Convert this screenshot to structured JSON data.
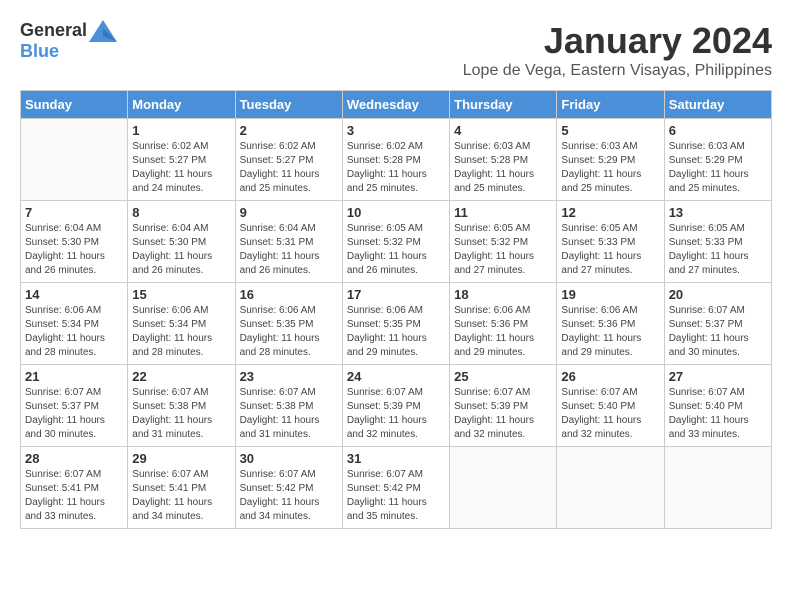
{
  "header": {
    "logo_line1": "General",
    "logo_line2": "Blue",
    "month_title": "January 2024",
    "location": "Lope de Vega, Eastern Visayas, Philippines"
  },
  "days_of_week": [
    "Sunday",
    "Monday",
    "Tuesday",
    "Wednesday",
    "Thursday",
    "Friday",
    "Saturday"
  ],
  "weeks": [
    [
      {
        "num": "",
        "sunrise": "",
        "sunset": "",
        "daylight": ""
      },
      {
        "num": "1",
        "sunrise": "Sunrise: 6:02 AM",
        "sunset": "Sunset: 5:27 PM",
        "daylight": "Daylight: 11 hours and 24 minutes."
      },
      {
        "num": "2",
        "sunrise": "Sunrise: 6:02 AM",
        "sunset": "Sunset: 5:27 PM",
        "daylight": "Daylight: 11 hours and 25 minutes."
      },
      {
        "num": "3",
        "sunrise": "Sunrise: 6:02 AM",
        "sunset": "Sunset: 5:28 PM",
        "daylight": "Daylight: 11 hours and 25 minutes."
      },
      {
        "num": "4",
        "sunrise": "Sunrise: 6:03 AM",
        "sunset": "Sunset: 5:28 PM",
        "daylight": "Daylight: 11 hours and 25 minutes."
      },
      {
        "num": "5",
        "sunrise": "Sunrise: 6:03 AM",
        "sunset": "Sunset: 5:29 PM",
        "daylight": "Daylight: 11 hours and 25 minutes."
      },
      {
        "num": "6",
        "sunrise": "Sunrise: 6:03 AM",
        "sunset": "Sunset: 5:29 PM",
        "daylight": "Daylight: 11 hours and 25 minutes."
      }
    ],
    [
      {
        "num": "7",
        "sunrise": "Sunrise: 6:04 AM",
        "sunset": "Sunset: 5:30 PM",
        "daylight": "Daylight: 11 hours and 26 minutes."
      },
      {
        "num": "8",
        "sunrise": "Sunrise: 6:04 AM",
        "sunset": "Sunset: 5:30 PM",
        "daylight": "Daylight: 11 hours and 26 minutes."
      },
      {
        "num": "9",
        "sunrise": "Sunrise: 6:04 AM",
        "sunset": "Sunset: 5:31 PM",
        "daylight": "Daylight: 11 hours and 26 minutes."
      },
      {
        "num": "10",
        "sunrise": "Sunrise: 6:05 AM",
        "sunset": "Sunset: 5:32 PM",
        "daylight": "Daylight: 11 hours and 26 minutes."
      },
      {
        "num": "11",
        "sunrise": "Sunrise: 6:05 AM",
        "sunset": "Sunset: 5:32 PM",
        "daylight": "Daylight: 11 hours and 27 minutes."
      },
      {
        "num": "12",
        "sunrise": "Sunrise: 6:05 AM",
        "sunset": "Sunset: 5:33 PM",
        "daylight": "Daylight: 11 hours and 27 minutes."
      },
      {
        "num": "13",
        "sunrise": "Sunrise: 6:05 AM",
        "sunset": "Sunset: 5:33 PM",
        "daylight": "Daylight: 11 hours and 27 minutes."
      }
    ],
    [
      {
        "num": "14",
        "sunrise": "Sunrise: 6:06 AM",
        "sunset": "Sunset: 5:34 PM",
        "daylight": "Daylight: 11 hours and 28 minutes."
      },
      {
        "num": "15",
        "sunrise": "Sunrise: 6:06 AM",
        "sunset": "Sunset: 5:34 PM",
        "daylight": "Daylight: 11 hours and 28 minutes."
      },
      {
        "num": "16",
        "sunrise": "Sunrise: 6:06 AM",
        "sunset": "Sunset: 5:35 PM",
        "daylight": "Daylight: 11 hours and 28 minutes."
      },
      {
        "num": "17",
        "sunrise": "Sunrise: 6:06 AM",
        "sunset": "Sunset: 5:35 PM",
        "daylight": "Daylight: 11 hours and 29 minutes."
      },
      {
        "num": "18",
        "sunrise": "Sunrise: 6:06 AM",
        "sunset": "Sunset: 5:36 PM",
        "daylight": "Daylight: 11 hours and 29 minutes."
      },
      {
        "num": "19",
        "sunrise": "Sunrise: 6:06 AM",
        "sunset": "Sunset: 5:36 PM",
        "daylight": "Daylight: 11 hours and 29 minutes."
      },
      {
        "num": "20",
        "sunrise": "Sunrise: 6:07 AM",
        "sunset": "Sunset: 5:37 PM",
        "daylight": "Daylight: 11 hours and 30 minutes."
      }
    ],
    [
      {
        "num": "21",
        "sunrise": "Sunrise: 6:07 AM",
        "sunset": "Sunset: 5:37 PM",
        "daylight": "Daylight: 11 hours and 30 minutes."
      },
      {
        "num": "22",
        "sunrise": "Sunrise: 6:07 AM",
        "sunset": "Sunset: 5:38 PM",
        "daylight": "Daylight: 11 hours and 31 minutes."
      },
      {
        "num": "23",
        "sunrise": "Sunrise: 6:07 AM",
        "sunset": "Sunset: 5:38 PM",
        "daylight": "Daylight: 11 hours and 31 minutes."
      },
      {
        "num": "24",
        "sunrise": "Sunrise: 6:07 AM",
        "sunset": "Sunset: 5:39 PM",
        "daylight": "Daylight: 11 hours and 32 minutes."
      },
      {
        "num": "25",
        "sunrise": "Sunrise: 6:07 AM",
        "sunset": "Sunset: 5:39 PM",
        "daylight": "Daylight: 11 hours and 32 minutes."
      },
      {
        "num": "26",
        "sunrise": "Sunrise: 6:07 AM",
        "sunset": "Sunset: 5:40 PM",
        "daylight": "Daylight: 11 hours and 32 minutes."
      },
      {
        "num": "27",
        "sunrise": "Sunrise: 6:07 AM",
        "sunset": "Sunset: 5:40 PM",
        "daylight": "Daylight: 11 hours and 33 minutes."
      }
    ],
    [
      {
        "num": "28",
        "sunrise": "Sunrise: 6:07 AM",
        "sunset": "Sunset: 5:41 PM",
        "daylight": "Daylight: 11 hours and 33 minutes."
      },
      {
        "num": "29",
        "sunrise": "Sunrise: 6:07 AM",
        "sunset": "Sunset: 5:41 PM",
        "daylight": "Daylight: 11 hours and 34 minutes."
      },
      {
        "num": "30",
        "sunrise": "Sunrise: 6:07 AM",
        "sunset": "Sunset: 5:42 PM",
        "daylight": "Daylight: 11 hours and 34 minutes."
      },
      {
        "num": "31",
        "sunrise": "Sunrise: 6:07 AM",
        "sunset": "Sunset: 5:42 PM",
        "daylight": "Daylight: 11 hours and 35 minutes."
      },
      {
        "num": "",
        "sunrise": "",
        "sunset": "",
        "daylight": ""
      },
      {
        "num": "",
        "sunrise": "",
        "sunset": "",
        "daylight": ""
      },
      {
        "num": "",
        "sunrise": "",
        "sunset": "",
        "daylight": ""
      }
    ]
  ]
}
